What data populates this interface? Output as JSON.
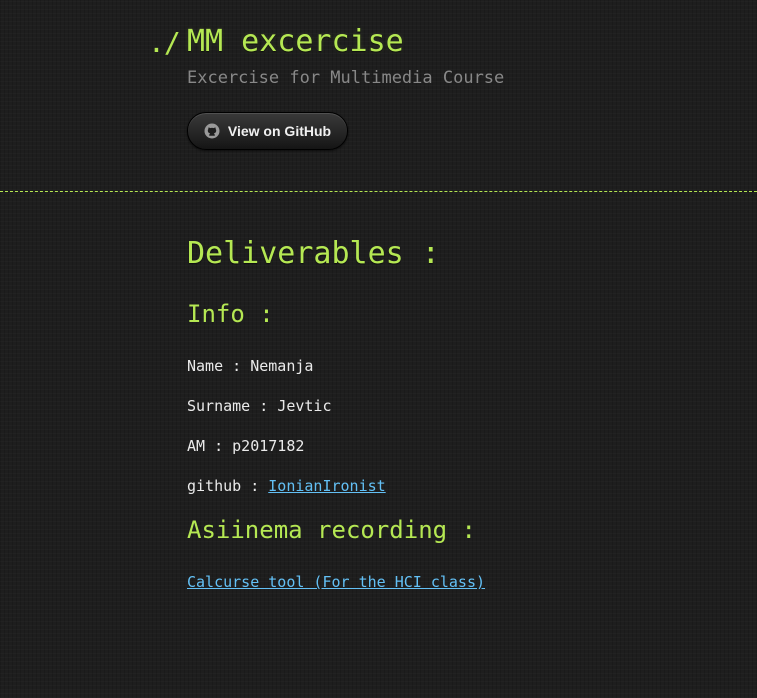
{
  "header": {
    "prompt": "./",
    "title": "MM excercise",
    "subtitle": "Excercise for Multimedia Course",
    "github_button_label": "View on GitHub",
    "github_button_icon": "github-icon"
  },
  "main": {
    "heading": "Deliverables :",
    "info_heading": "Info :",
    "fields": {
      "name_label": "Name : ",
      "name_value": "Nemanja",
      "surname_label": "Surname : ",
      "surname_value": "Jevtic",
      "am_label": "AM : ",
      "am_value": "p2017182",
      "github_label": "github : ",
      "github_value": "IonianIronist"
    },
    "recording_heading": "Asiinema recording :",
    "recording_link": "Calcurse tool (For the HCI class)"
  },
  "colors": {
    "background": "#1e1e1e",
    "accent": "#b5e853",
    "link": "#63c0f5",
    "text": "#eaeaea",
    "muted": "#888888"
  }
}
